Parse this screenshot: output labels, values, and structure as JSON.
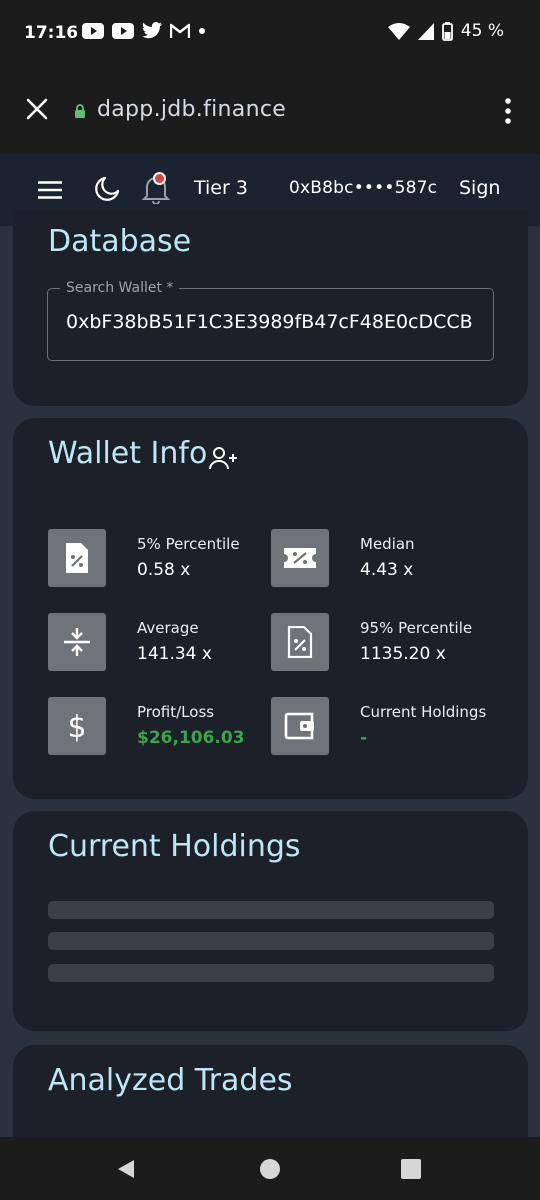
{
  "status_bar": {
    "time": "17:16",
    "notifications": [
      "youtube-icon",
      "youtube-icon",
      "twitter-icon",
      "gmail-icon",
      "dot-icon"
    ],
    "battery": "45 %"
  },
  "browser": {
    "url": "dapp.jdb.finance"
  },
  "header": {
    "tier": "Tier 3",
    "wallet_address": "0xB8bc••••587c",
    "sign_label": "Sign"
  },
  "database": {
    "title": "Database",
    "search_label": "Search Wallet *",
    "search_value": "0xbF38bB51F1C3E3989fB47cF48E0cDCCB"
  },
  "wallet_info": {
    "title": "Wallet Info",
    "stats": [
      {
        "label": "5% Percentile",
        "value": "0.58 x",
        "icon": "percent-file-icon"
      },
      {
        "label": "Median",
        "value": "4.43 x",
        "icon": "percent-ticket-icon"
      },
      {
        "label": "Average",
        "value": "141.34 x",
        "icon": "compress-arrows-icon"
      },
      {
        "label": "95% Percentile",
        "value": "1135.20 x",
        "icon": "percent-file-icon"
      },
      {
        "label": "Profit/Loss",
        "value": "$26,106.03",
        "icon": "dollar-icon",
        "color": "#3aa54a"
      },
      {
        "label": "Current Holdings",
        "value": "-",
        "icon": "wallet-icon",
        "color": "#3aa54a"
      }
    ]
  },
  "current_holdings": {
    "title": "Current Holdings"
  },
  "analyzed_trades": {
    "title": "Analyzed Trades"
  }
}
